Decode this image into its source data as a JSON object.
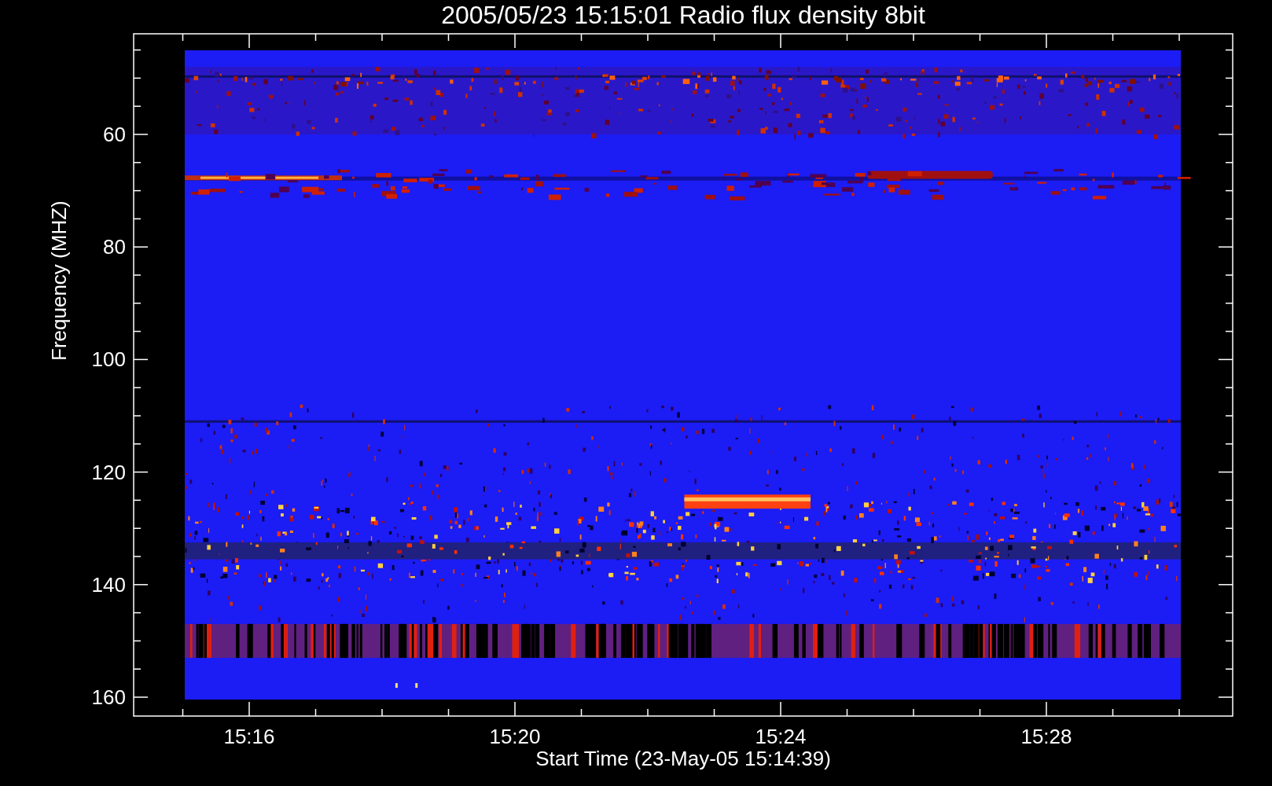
{
  "plot": {
    "title": "2005/05/23 15:15:01 Radio flux density 8bit",
    "ylabel": "Frequency (MHZ)",
    "xlabel": "Start Time (23-May-05 15:14:39)",
    "y_tick_labels": [
      "60",
      "80",
      "100",
      "120",
      "140",
      "160"
    ],
    "x_tick_labels": [
      "15:16",
      "15:20",
      "15:24",
      "15:28"
    ]
  }
}
